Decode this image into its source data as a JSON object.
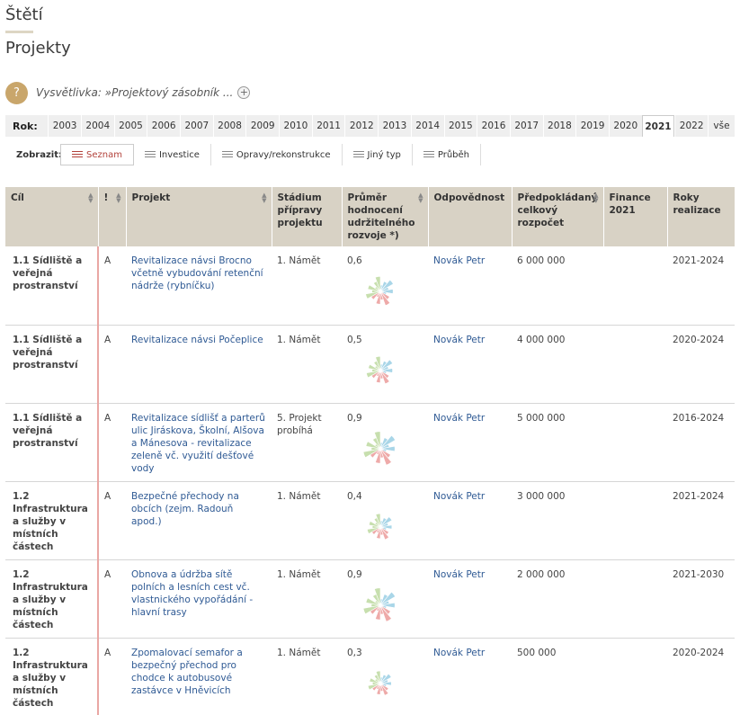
{
  "city": "Štětí",
  "page_title": "Projekty",
  "legend": {
    "text": "Vysvětlivka: »Projektový zásobník ...",
    "help_symbol": "?",
    "expand_symbol": "+"
  },
  "years": {
    "label": "Rok:",
    "items": [
      "2003",
      "2004",
      "2005",
      "2006",
      "2007",
      "2008",
      "2009",
      "2010",
      "2011",
      "2012",
      "2013",
      "2014",
      "2015",
      "2016",
      "2017",
      "2018",
      "2019",
      "2020",
      "2021",
      "2022",
      "vše"
    ],
    "active": "2021"
  },
  "view": {
    "label": "Zobrazit:",
    "options": [
      "Seznam",
      "Investice",
      "Opravy/rekonstrukce",
      "Jiný typ",
      "Průběh"
    ],
    "active": "Seznam"
  },
  "table": {
    "headers": [
      "Cíl",
      "!",
      "Projekt",
      "Stádium přípravy projektu",
      "Průměr hodnocení udržitelného rozvoje *)",
      "Odpovědnost",
      "Předpokládaný celkový rozpočet",
      "Finance 2021",
      "Roky realizace"
    ],
    "rows": [
      {
        "goal": "1.1 Sídliště a veřejná prostranství",
        "priority": "A",
        "project": "Revitalizace návsi Brocno včetně vybudování retenční nádrže (rybníčku)",
        "stage": "1. Námět",
        "score": "0,6",
        "owner": "Novák Petr",
        "budget": "6 000 000",
        "finance": "",
        "years": "2021-2024"
      },
      {
        "goal": "1.1 Sídliště a veřejná prostranství",
        "priority": "A",
        "project": "Revitalizace návsi Počeplice",
        "stage": "1. Námět",
        "score": "0,5",
        "owner": "Novák Petr",
        "budget": "4 000 000",
        "finance": "",
        "years": "2020-2024"
      },
      {
        "goal": "1.1 Sídliště a veřejná prostranství",
        "priority": "A",
        "project": "Revitalizace sídlišť a parterů ulic Jiráskova, Školní, Alšova a Mánesova - revitalizace zeleně vč. využití dešťové vody",
        "stage": "5. Projekt probíhá",
        "score": "0,9",
        "owner": "Novák Petr",
        "budget": "5 000 000",
        "finance": "",
        "years": "2016-2024"
      },
      {
        "goal": "1.2 Infrastruktura a služby v místních částech",
        "priority": "A",
        "project": "Bezpečné přechody na obcích (zejm. Radouň apod.)",
        "stage": "1. Námět",
        "score": "0,4",
        "owner": "Novák Petr",
        "budget": "3 000 000",
        "finance": "",
        "years": "2021-2024"
      },
      {
        "goal": "1.2 Infrastruktura a služby v místních částech",
        "priority": "A",
        "project": "Obnova a údržba sítě polních a lesních cest vč. vlastnického vypořádání - hlavní trasy",
        "stage": "1. Námět",
        "score": "0,9",
        "owner": "Novák Petr",
        "budget": "2 000 000",
        "finance": "",
        "years": "2021-2030"
      },
      {
        "goal": "1.2 Infrastruktura a služby v místních částech",
        "priority": "A",
        "project": "Zpomalovací semafor a bezpečný přechod pro chodce k autobusové zastávce v Hněvicích",
        "stage": "1. Námět",
        "score": "0,3",
        "owner": "Novák Petr",
        "budget": "500 000",
        "finance": "",
        "years": "2020-2024"
      }
    ]
  },
  "rose_chart_colors": {
    "green": "#c7dfae",
    "blue": "#a9d6e8",
    "red": "#eeaaa9"
  },
  "rose_icon": "sustainability-rose-icon"
}
